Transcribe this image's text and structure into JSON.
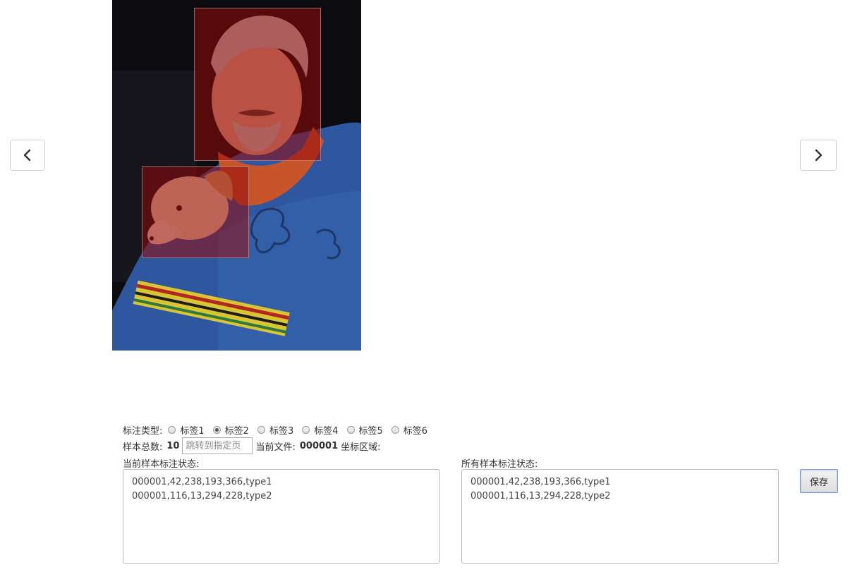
{
  "navigation": {
    "prev_icon": "chevron-left-icon",
    "next_icon": "chevron-right-icon"
  },
  "image": {
    "description_icon": "annotated-photo"
  },
  "controls": {
    "annotation_type_label": "标注类型:",
    "labels": [
      {
        "text": "标签1",
        "checked": false
      },
      {
        "text": "标签2",
        "checked": true
      },
      {
        "text": "标签3",
        "checked": false
      },
      {
        "text": "标签4",
        "checked": false
      },
      {
        "text": "标签5",
        "checked": false
      },
      {
        "text": "标签6",
        "checked": false
      }
    ],
    "total_samples_label": "样本总数:",
    "total_samples_value": "10",
    "jump_placeholder": "跳转到指定页",
    "current_file_label": "当前文件:",
    "current_file_value": "000001",
    "coord_area_label": "坐标区域:"
  },
  "current_status": {
    "label": "当前样本标注状态:",
    "lines": [
      "000001,42,238,193,366,type1",
      "000001,116,13,294,228,type2"
    ]
  },
  "all_status": {
    "label": "所有样本标注状态:",
    "lines": [
      "000001,42,238,193,366,type1",
      "000001,116,13,294,228,type2"
    ]
  },
  "save_button": "保存",
  "colors": {
    "annotation_fill": "#960a0a",
    "sweater": "#2f57a0"
  }
}
